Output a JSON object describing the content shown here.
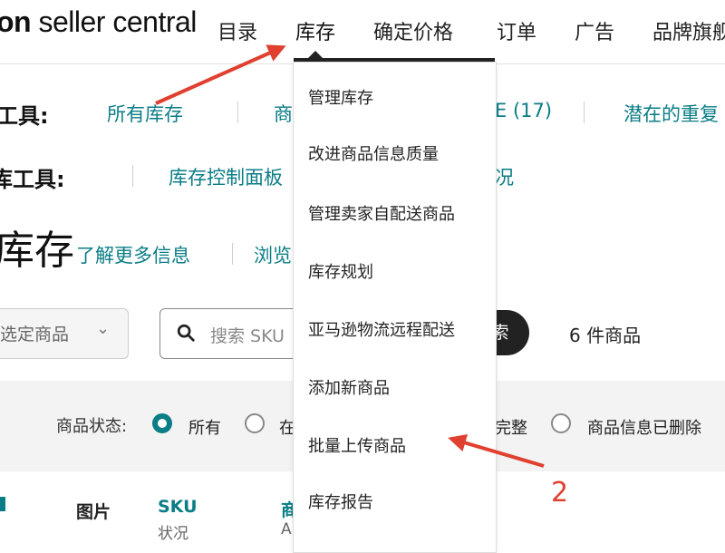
{
  "nav": {
    "brand_bold": "on",
    "brand_rest": " seller central",
    "items": [
      "目录",
      "库存",
      "确定价格",
      "订单",
      "广告",
      "品牌旗舰"
    ]
  },
  "toolbar1": {
    "label": "工具:",
    "links": [
      "所有库存",
      "商",
      "E (17)",
      "潜在的重复"
    ]
  },
  "toolbar2": {
    "label": "库工具:",
    "links": [
      "库存控制面板",
      "况"
    ]
  },
  "page": {
    "title": "库存",
    "learn_more": "了解更多信息",
    "browse": "浏览"
  },
  "controls": {
    "select_text": "选定商品",
    "search_placeholder": "搜索 SKU",
    "search_button": "索",
    "count_text": "6 件商品"
  },
  "filters": {
    "label": "商品状态:",
    "options": [
      "所有",
      "在",
      "完整",
      "商品信息已删除"
    ]
  },
  "table_headers": {
    "image": "图片",
    "sku": "SKU",
    "sku_sub": "状况",
    "name_fragment": "商",
    "name_sub_fragment": "A"
  },
  "dropdown": {
    "items": [
      "管理库存",
      "改进商品信息质量",
      "管理卖家自配送商品",
      "库存规划",
      "亚马逊物流远程配送",
      "添加新商品",
      "批量上传商品",
      "库存报告"
    ]
  },
  "annotation": {
    "number": "2"
  },
  "colors": {
    "teal": "#0a7d86",
    "annotation_red": "#e04030"
  }
}
